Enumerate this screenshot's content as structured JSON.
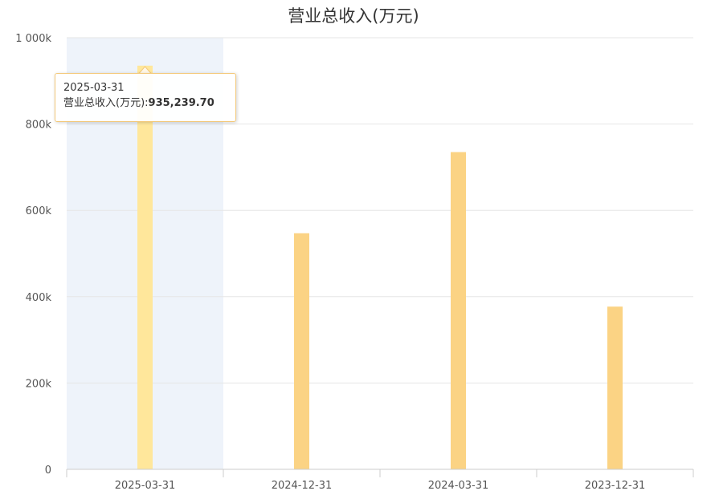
{
  "chart_data": {
    "type": "bar",
    "title": "营业总收入(万元)",
    "categories": [
      "2025-03-31",
      "2024-12-31",
      "2024-03-31",
      "2023-12-31"
    ],
    "series": [
      {
        "values": [
          935239.7,
          547000,
          735000,
          377000
        ]
      }
    ],
    "ylim": [
      0,
      1000000
    ],
    "y_ticks": [
      "0",
      "200k",
      "400k",
      "600k",
      "800k",
      "1 000k"
    ],
    "y_tick_values": [
      0,
      200000,
      400000,
      600000,
      800000,
      1000000
    ],
    "grid": true,
    "highlight_index": 0,
    "colors": {
      "bar": "#fbd384",
      "bar_highlight": "#ffe79b",
      "highlight_band": "#eef3fa",
      "grid": "#e6e6e6"
    }
  },
  "tooltip": {
    "date": "2025-03-31",
    "label": "营业总收入(万元):",
    "value": "935,239.70"
  }
}
